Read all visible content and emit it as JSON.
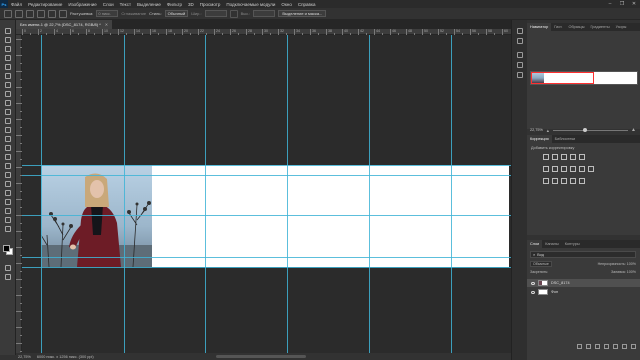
{
  "menu": {
    "logo": "Ps",
    "items": [
      "Файл",
      "Редактирование",
      "Изображение",
      "Слои",
      "Текст",
      "Выделение",
      "Фильтр",
      "3D",
      "Просмотр",
      "Подключаемые модули",
      "Окно",
      "Справка"
    ]
  },
  "window_controls": {
    "minimize": "–",
    "restore": "❐",
    "close": "✕"
  },
  "options": {
    "feather_label": "Растушевка:",
    "feather_value": "0 пикс.",
    "antialias_label": "Сглаживание",
    "style_label": "Стиль:",
    "style_value": "Обычный",
    "width_label": "Шир.:",
    "height_label": "Выс.:",
    "select_mask_button": "Выделение и маска..."
  },
  "document_tab": {
    "title": "Без имени-1 @ 22,7% (DSC_8174, RGB/8) *",
    "close": "✕"
  },
  "ruler_numbers": [
    "0",
    "2",
    "4",
    "6",
    "8",
    "10",
    "12",
    "14",
    "16",
    "18",
    "20",
    "22",
    "24",
    "26",
    "28",
    "30",
    "32",
    "34",
    "36",
    "38",
    "40",
    "42",
    "44",
    "46",
    "48",
    "50",
    "52",
    "54",
    "56",
    "58",
    "60"
  ],
  "status": {
    "zoom": "22,75%",
    "doc_size": "6000 пикс. x 1256 пикс. (300 ppi)"
  },
  "panels": {
    "navigator_tabs": [
      "Навигатор",
      "Гист.",
      "Образцы",
      "Градиенты",
      "Узоры"
    ],
    "navigator_zoom": "22,75%",
    "adjustment_tabs": [
      "Коррекция",
      "Библиотеки"
    ],
    "adjustment_title": "Добавить корректировку",
    "layers_tabs": [
      "Слои",
      "Каналы",
      "Контуры"
    ],
    "layer_filter": "Вид",
    "blend_mode": "Обычные",
    "opacity_label": "Непрозрачность:",
    "opacity_value": "100%",
    "lock_label": "Закрепить:",
    "fill_label": "Заливка:",
    "fill_value": "100%",
    "layers": [
      {
        "name": "DSC_8174",
        "selected": true
      },
      {
        "name": "Фон",
        "selected": false
      }
    ]
  },
  "colors": {
    "guides": "#3fb4d6",
    "nav_view_box": "#ff3030",
    "ps_blue": "#31a8ff"
  }
}
